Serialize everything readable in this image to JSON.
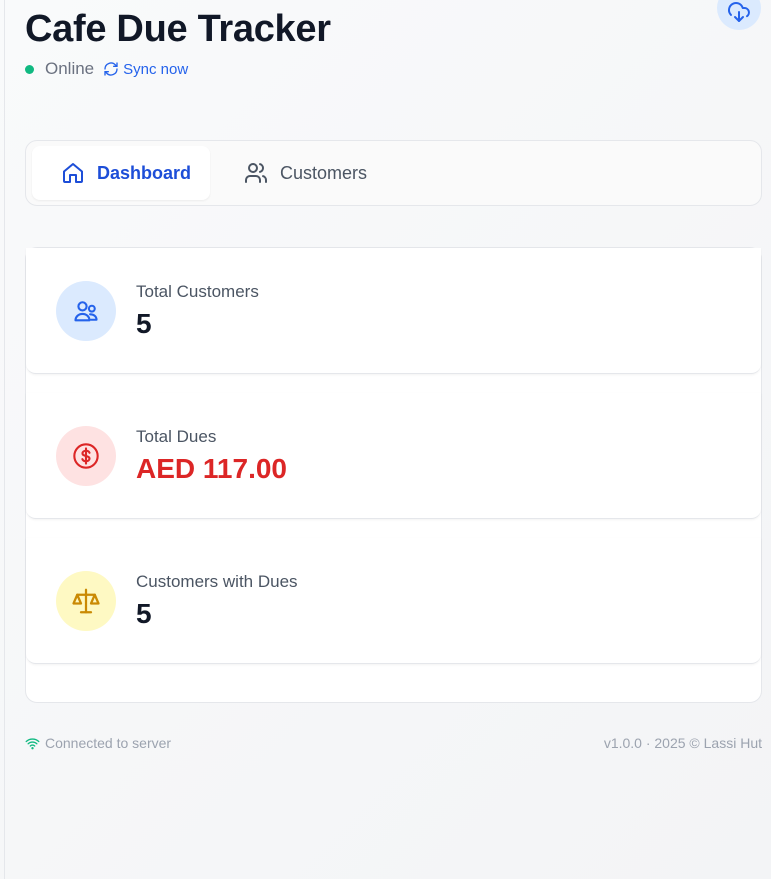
{
  "header": {
    "title": "Cafe Due Tracker",
    "status": "Online",
    "sync_label": "Sync now"
  },
  "tabs": [
    {
      "label": "Dashboard",
      "active": true,
      "icon": "home-icon"
    },
    {
      "label": "Customers",
      "active": false,
      "icon": "users-icon"
    }
  ],
  "stats": [
    {
      "label": "Total Customers",
      "value": "5",
      "icon": "users-icon"
    },
    {
      "label": "Total Dues",
      "value": "AED 117.00",
      "icon": "dollar-icon"
    },
    {
      "label": "Customers with Dues",
      "value": "5",
      "icon": "scale-icon"
    }
  ],
  "footer": {
    "connection": "Connected to server",
    "version": "v1.0.0 · 2025 © Lassi Hut"
  },
  "colors": {
    "accent": "#2563eb",
    "online": "#10b981",
    "dues": "#dc2626",
    "users_bg": "#dbeafe",
    "dues_bg": "#fee2e2",
    "scale_bg": "#fef9c3",
    "scale_icon": "#ca8a04"
  }
}
